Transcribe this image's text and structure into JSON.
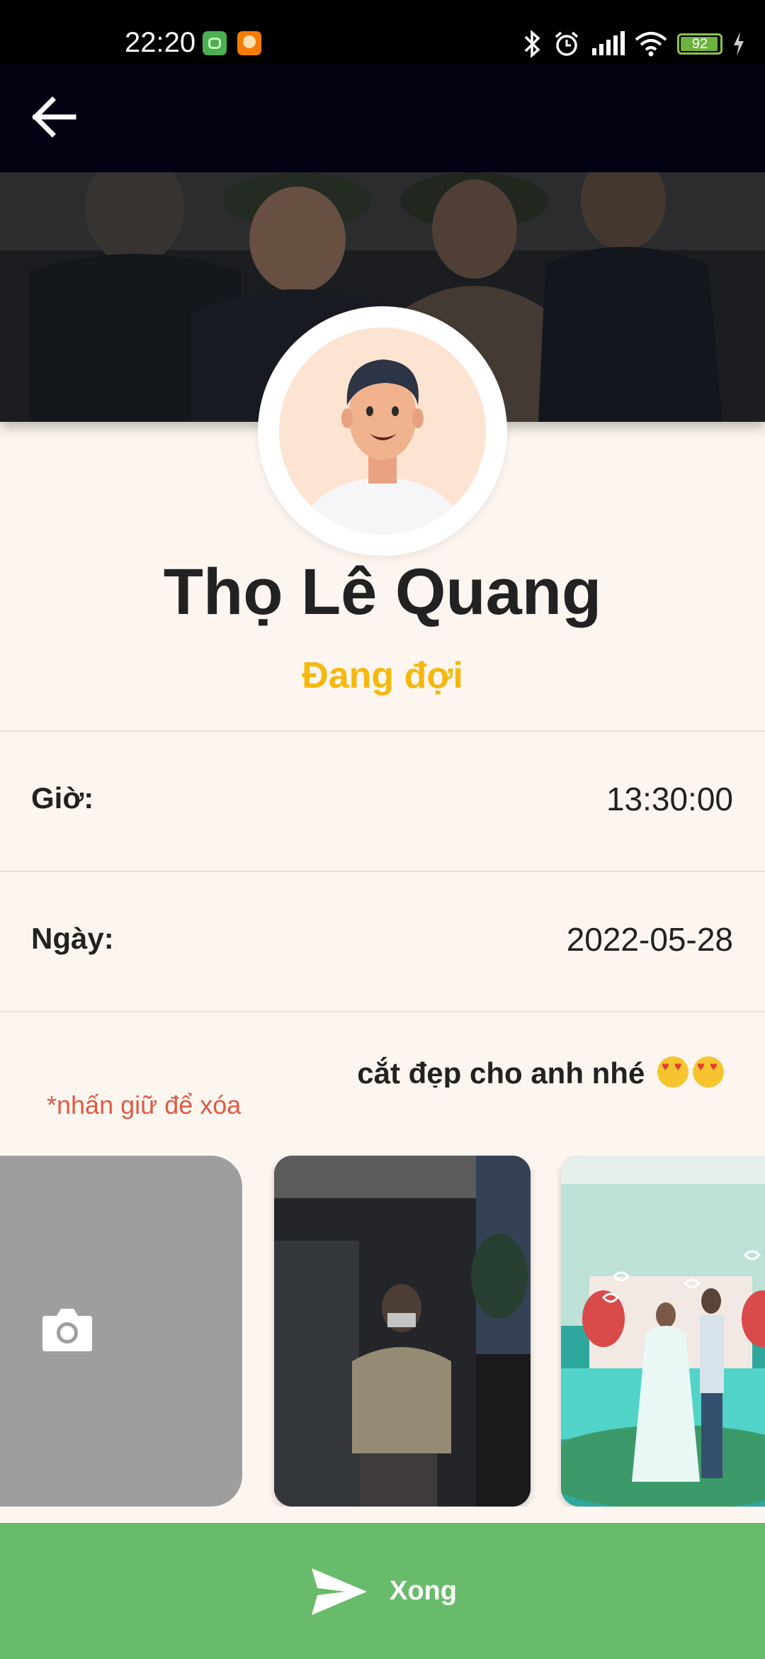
{
  "statusbar": {
    "time": "22:20",
    "battery": "92",
    "app_icons": [
      "green-app-icon",
      "orange-app-icon"
    ],
    "icons": [
      "bluetooth-icon",
      "alarm-icon",
      "signal-icon",
      "wifi-icon",
      "battery-icon",
      "charging-icon"
    ]
  },
  "header": {
    "back_icon": "arrow-left-icon"
  },
  "profile": {
    "name": "Thọ Lê Quang",
    "status": "Đang đợi",
    "status_color": "#f5b80e"
  },
  "details": {
    "time_label": "Giờ:",
    "time_value": "13:30:00",
    "date_label": "Ngày:",
    "date_value": "2022-05-28"
  },
  "note": "cắt đẹp cho anh nhé",
  "hint": "*nhấn giữ để xóa",
  "gallery": {
    "add_icon": "camera-icon",
    "photos": 2
  },
  "action": {
    "done_label": "Xong",
    "icon": "send-icon",
    "color": "#67bb6a"
  }
}
